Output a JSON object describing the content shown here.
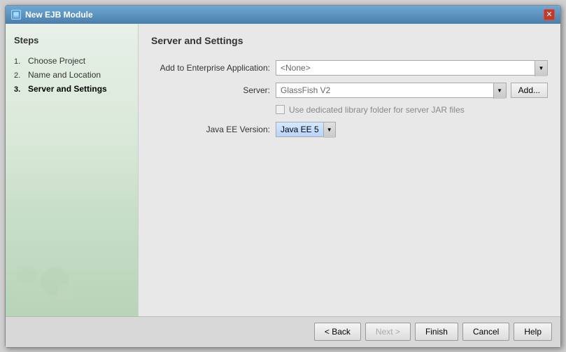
{
  "window": {
    "title": "New EJB Module",
    "close_label": "✕"
  },
  "sidebar": {
    "heading": "Steps",
    "steps": [
      {
        "num": "1.",
        "label": "Choose Project",
        "active": false
      },
      {
        "num": "2.",
        "label": "Name and Location",
        "active": false
      },
      {
        "num": "3.",
        "label": "Server and Settings",
        "active": true
      }
    ]
  },
  "main": {
    "title": "Server and Settings",
    "fields": {
      "add_to_enterprise_label": "Add to Enterprise Application:",
      "add_to_enterprise_value": "<None>",
      "server_label": "Server:",
      "server_value": "GlassFish V2",
      "add_button_label": "Add...",
      "checkbox_label": "Use dedicated library folder for server JAR files",
      "java_ee_label": "Java EE Version:",
      "java_ee_value": "Java EE 5"
    }
  },
  "footer": {
    "back_label": "< Back",
    "next_label": "Next >",
    "finish_label": "Finish",
    "cancel_label": "Cancel",
    "help_label": "Help"
  }
}
